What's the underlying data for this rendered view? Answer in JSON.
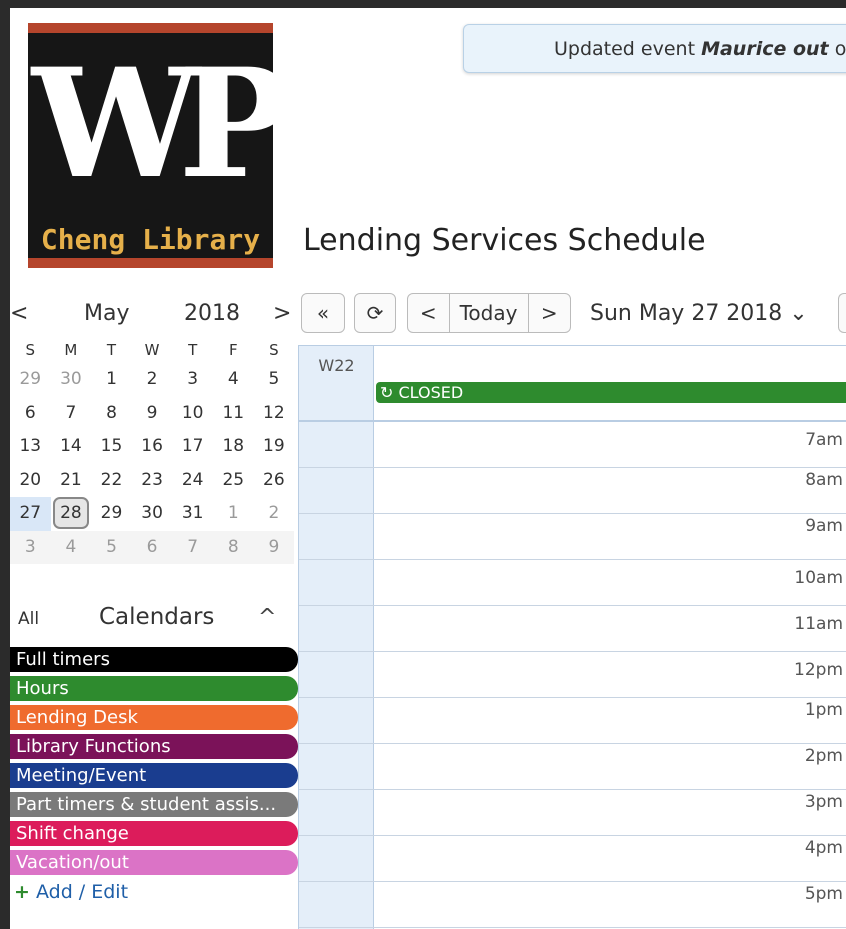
{
  "header": {
    "logo_letters": "WP",
    "logo_name": "Cheng Library",
    "notice_prefix": "Updated event",
    "notice_event": "Maurice out",
    "notice_suffix": " o",
    "title": "Lending Services Schedule"
  },
  "mini_calendar": {
    "prev": "<",
    "next": ">",
    "month": "May",
    "year": "2018",
    "dow": [
      "S",
      "M",
      "T",
      "W",
      "T",
      "F",
      "S"
    ],
    "weeks": [
      [
        "29",
        "30",
        "1",
        "2",
        "3",
        "4",
        "5"
      ],
      [
        "6",
        "7",
        "8",
        "9",
        "10",
        "11",
        "12"
      ],
      [
        "13",
        "14",
        "15",
        "16",
        "17",
        "18",
        "19"
      ],
      [
        "20",
        "21",
        "22",
        "23",
        "24",
        "25",
        "26"
      ],
      [
        "27",
        "28",
        "29",
        "30",
        "31",
        "1",
        "2"
      ],
      [
        "3",
        "4",
        "5",
        "6",
        "7",
        "8",
        "9"
      ]
    ]
  },
  "calendars": {
    "all": "All",
    "title": "Calendars",
    "collapse": "^",
    "items": [
      {
        "label": "Full timers",
        "color": "#000000"
      },
      {
        "label": "Hours",
        "color": "#2e8b2e"
      },
      {
        "label": "Lending Desk",
        "color": "#ef6b2e"
      },
      {
        "label": "Library Functions",
        "color": "#7b1259"
      },
      {
        "label": "Meeting/Event",
        "color": "#1a3d8f"
      },
      {
        "label": "Part timers & student assis...",
        "color": "#7a7a7a"
      },
      {
        "label": "Shift change",
        "color": "#dc1c5b"
      },
      {
        "label": "Vacation/out",
        "color": "#db73c6"
      }
    ],
    "add_edit": "Add / Edit"
  },
  "toolbar": {
    "back_fast": "«",
    "refresh": "⟳",
    "prev": "<",
    "today": "Today",
    "next": ">",
    "date": "Sun May 27 2018",
    "date_chevron": "⌄"
  },
  "day_view": {
    "week_label": "W22",
    "all_day_event": "CLOSED",
    "hours": [
      "7am",
      "8am",
      "9am",
      "10am",
      "11am",
      "12pm",
      "1pm",
      "2pm",
      "3pm",
      "4pm",
      "5pm"
    ]
  }
}
